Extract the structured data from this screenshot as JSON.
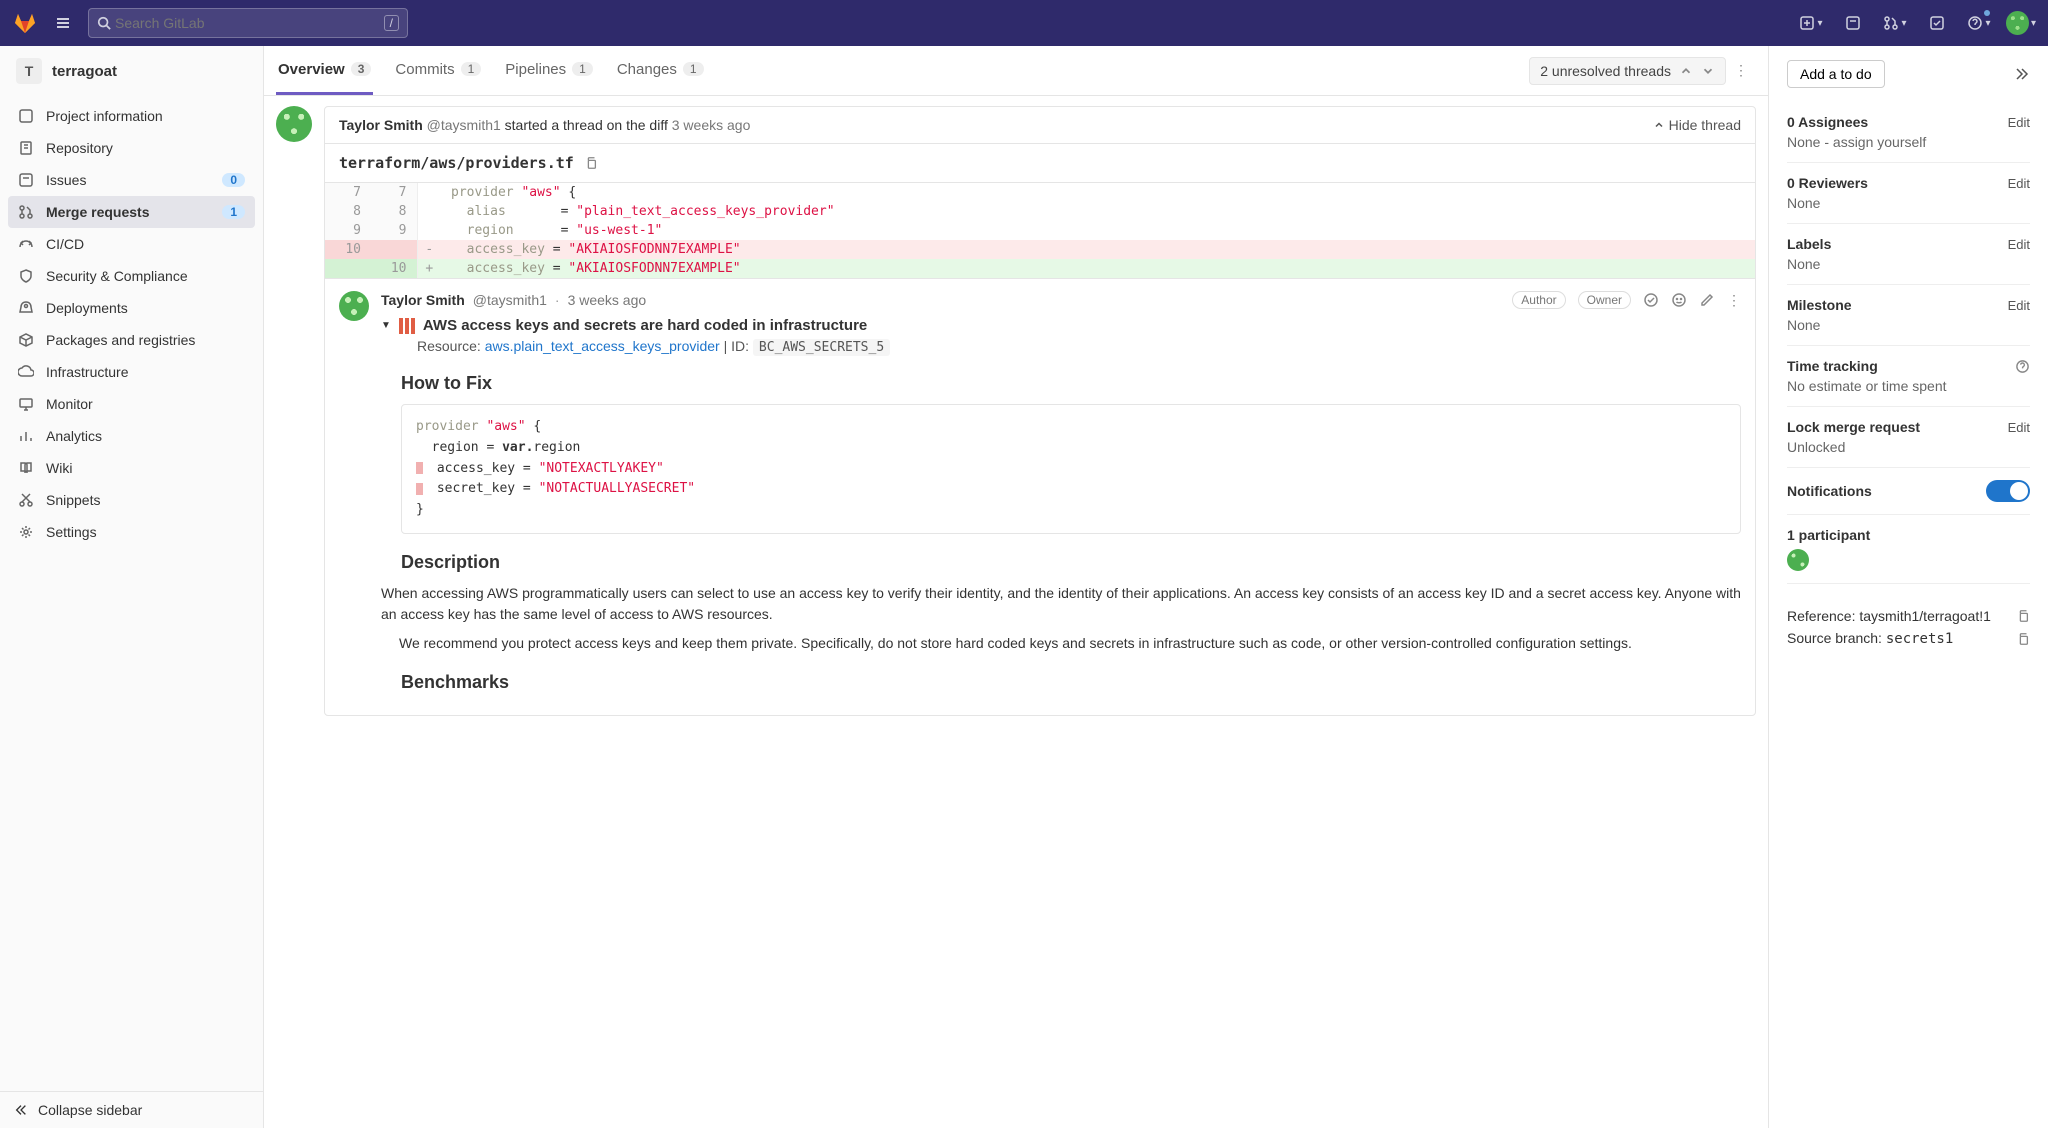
{
  "topbar": {
    "search_placeholder": "Search GitLab",
    "shortcut": "/"
  },
  "project": {
    "badge": "T",
    "name": "terragoat"
  },
  "sidebar": {
    "items": [
      {
        "label": "Project information"
      },
      {
        "label": "Repository"
      },
      {
        "label": "Issues",
        "badge": "0"
      },
      {
        "label": "Merge requests",
        "badge": "1",
        "active": true
      },
      {
        "label": "CI/CD"
      },
      {
        "label": "Security & Compliance"
      },
      {
        "label": "Deployments"
      },
      {
        "label": "Packages and registries"
      },
      {
        "label": "Infrastructure"
      },
      {
        "label": "Monitor"
      },
      {
        "label": "Analytics"
      },
      {
        "label": "Wiki"
      },
      {
        "label": "Snippets"
      },
      {
        "label": "Settings"
      }
    ],
    "collapse": "Collapse sidebar"
  },
  "tabs": {
    "overview": {
      "label": "Overview",
      "count": "3"
    },
    "commits": {
      "label": "Commits",
      "count": "1"
    },
    "pipelines": {
      "label": "Pipelines",
      "count": "1"
    },
    "changes": {
      "label": "Changes",
      "count": "1"
    },
    "threads": "2 unresolved threads"
  },
  "thread": {
    "header": {
      "user": "Taylor Smith",
      "handle": "@taysmith1",
      "action": "started a thread on the diff",
      "time": "3 weeks ago",
      "hide": "Hide thread"
    },
    "file": "terraform/aws/providers.tf",
    "diff": {
      "r1": {
        "old": "7",
        "new": "7",
        "sign": "",
        "code": "provider \"aws\" {"
      },
      "r2": {
        "old": "8",
        "new": "8",
        "sign": "",
        "code": "  alias       = \"plain_text_access_keys_provider\""
      },
      "r3": {
        "old": "9",
        "new": "9",
        "sign": "",
        "code": "  region      = \"us-west-1\""
      },
      "r4": {
        "old": "10",
        "new": "",
        "sign": "-",
        "code": "  access_key = \"AKIAIOSFODNN7EXAMPLE\""
      },
      "r5": {
        "old": "",
        "new": "10",
        "sign": "+",
        "code": "  access_key = \"AKIAIOSFODNN7EXAMPLE\""
      }
    }
  },
  "comment": {
    "user": "Taylor Smith",
    "handle": "@taysmith1",
    "sep": "·",
    "time": "3 weeks ago",
    "author": "Author",
    "owner": "Owner",
    "title": "AWS access keys and secrets are hard coded in infrastructure",
    "resource_label": "Resource: ",
    "resource_link": "aws.plain_text_access_keys_provider",
    "id_label": " | ID: ",
    "id_value": "BC_AWS_SECRETS_5",
    "howto": "How to Fix",
    "fix": {
      "l1": "provider \"aws\" {",
      "l2": "  region = var.region",
      "l3": "  access_key = \"NOTEXACTLYAKEY\"",
      "l4": "  secret_key = \"NOTACTUALLYASECRET\"",
      "l5": "}"
    },
    "desc_h": "Description",
    "desc_p1": "When accessing AWS programmatically users can select to use an access key to verify their identity, and the identity of their applications. An access key consists of an access key ID and a secret access key. Anyone with an access key has the same level of access to AWS resources.",
    "desc_p2": "We recommend you protect access keys and keep them private. Specifically, do not store hard coded keys and secrets in infrastructure such as code, or other version-controlled configuration settings.",
    "bench_h": "Benchmarks"
  },
  "rpanel": {
    "todo": "Add a to do",
    "edit": "Edit",
    "assignees": {
      "title": "0 Assignees",
      "value": "None - assign yourself"
    },
    "reviewers": {
      "title": "0 Reviewers",
      "value": "None"
    },
    "labels": {
      "title": "Labels",
      "value": "None"
    },
    "milestone": {
      "title": "Milestone",
      "value": "None"
    },
    "time": {
      "title": "Time tracking",
      "value": "No estimate or time spent"
    },
    "lock": {
      "title": "Lock merge request",
      "value": "Unlocked"
    },
    "notifications": "Notifications",
    "participants": "1 participant",
    "reference": {
      "label": "Reference: ",
      "value": "taysmith1/terragoat!1"
    },
    "branch": {
      "label": "Source branch: ",
      "value": "secrets1"
    }
  }
}
